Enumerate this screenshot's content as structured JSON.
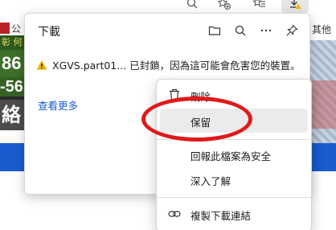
{
  "toolbar": {
    "icons": [
      "zoom-icon",
      "favorites-add-icon",
      "favorites-icon",
      "downloads-warning-icon"
    ]
  },
  "background": {
    "left_tag": "公",
    "banner_line1": "86",
    "banner_line2": "-56",
    "banner_line3": "絡",
    "banner_small": "彰 何",
    "right_text": "其他"
  },
  "downloads": {
    "title": "下載",
    "warning_text": "XGVS.part01... 已封鎖，因為這可能會危害您的裝置。",
    "see_more": "查看更多"
  },
  "context_menu": {
    "items": [
      {
        "label": "刪除",
        "icon": "trash-icon"
      },
      {
        "label": "保留",
        "icon": ""
      },
      {
        "label": "回報此檔案為安全",
        "icon": ""
      },
      {
        "label": "深入了解",
        "icon": ""
      },
      {
        "label": "複製下載連結",
        "icon": "link-icon"
      }
    ]
  },
  "colors": {
    "accent": "#1a5ccf",
    "warning": "#f2b400",
    "annotation": "#e01a1a",
    "hover": "#ebebeb"
  }
}
